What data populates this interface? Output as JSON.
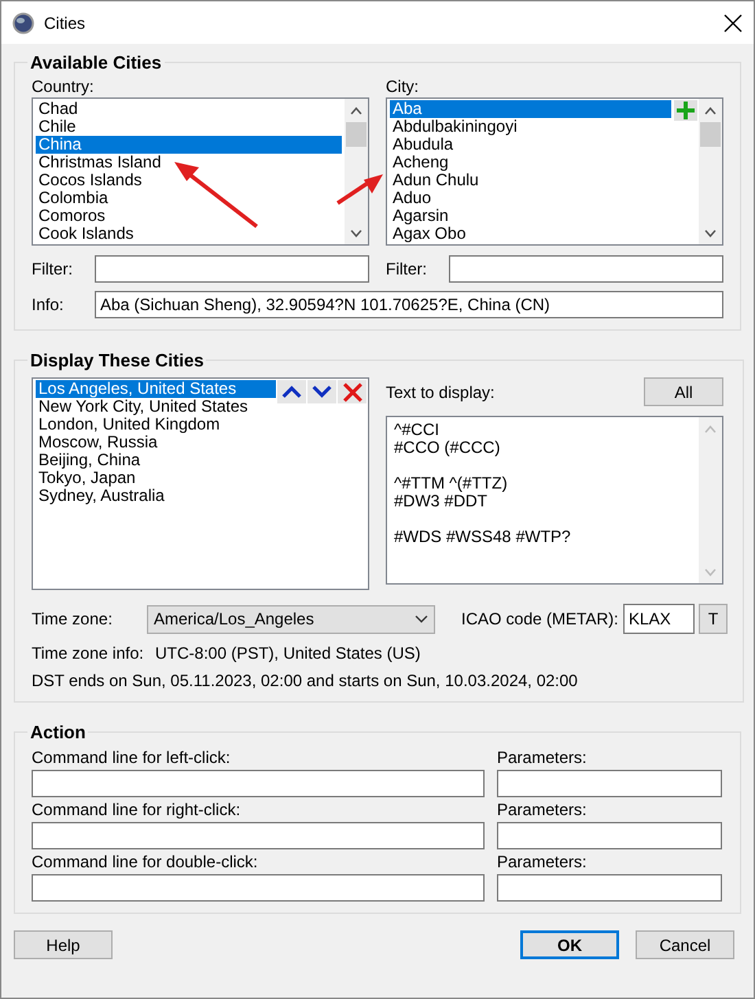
{
  "window": {
    "title": "Cities"
  },
  "available": {
    "title": "Available Cities",
    "country_label": "Country:",
    "city_label": "City:",
    "countries": [
      {
        "name": "Chad",
        "selected": false
      },
      {
        "name": "Chile",
        "selected": false
      },
      {
        "name": "China",
        "selected": true
      },
      {
        "name": "Christmas Island",
        "selected": false
      },
      {
        "name": "Cocos Islands",
        "selected": false
      },
      {
        "name": "Colombia",
        "selected": false
      },
      {
        "name": "Comoros",
        "selected": false
      },
      {
        "name": "Cook Islands",
        "selected": false
      }
    ],
    "cities": [
      {
        "name": "Aba",
        "selected": true
      },
      {
        "name": "Abdulbakiningoyi",
        "selected": false
      },
      {
        "name": "Abudula",
        "selected": false
      },
      {
        "name": "Acheng",
        "selected": false
      },
      {
        "name": "Adun Chulu",
        "selected": false
      },
      {
        "name": "Aduo",
        "selected": false
      },
      {
        "name": "Agarsin",
        "selected": false
      },
      {
        "name": "Agax Obo",
        "selected": false
      }
    ],
    "country_filter": {
      "label": "Filter:"
    },
    "city_filter": {
      "label": "Filter:"
    },
    "info": {
      "label": "Info:",
      "value": "Aba (Sichuan Sheng), 32.90594?N  101.70625?E, China (CN)"
    }
  },
  "display": {
    "title": "Display These Cities",
    "cities": [
      {
        "name": "Los Angeles, United States",
        "selected": true
      },
      {
        "name": "New York City, United States",
        "selected": false
      },
      {
        "name": "London, United Kingdom",
        "selected": false
      },
      {
        "name": "Moscow, Russia",
        "selected": false
      },
      {
        "name": "Beijing, China",
        "selected": false
      },
      {
        "name": "Tokyo, Japan",
        "selected": false
      },
      {
        "name": "Sydney, Australia",
        "selected": false
      }
    ],
    "text_label": "Text to display:",
    "all_button": "All",
    "text_paragraphs": [
      [
        "^#CCI",
        "#CCO (#CCC)"
      ],
      [
        "^#TTM ^(#TTZ)",
        "#DW3 #DDT"
      ],
      [
        "#WDS #WSS48 #WTP?"
      ]
    ],
    "time_zone": {
      "label": "Time zone:",
      "value": "America/Los_Angeles"
    },
    "icao": {
      "label": "ICAO code (METAR):",
      "value": "KLAX",
      "button": "T"
    },
    "tz_info": {
      "label": "Time zone info:",
      "value": "UTC-8:00 (PST), United States (US)"
    },
    "dst": "DST ends on Sun, 05.11.2023, 02:00 and starts on Sun, 10.03.2024, 02:00"
  },
  "action": {
    "title": "Action",
    "rows": [
      {
        "label": "Command line for left-click:",
        "params_label": "Parameters:"
      },
      {
        "label": "Command line for right-click:",
        "params_label": "Parameters:"
      },
      {
        "label": "Command line for double-click:",
        "params_label": "Parameters:"
      }
    ]
  },
  "buttons": [
    {
      "label": "Help",
      "default": false
    },
    {
      "label": "OK",
      "default": true
    },
    {
      "label": "Cancel",
      "default": false
    }
  ]
}
